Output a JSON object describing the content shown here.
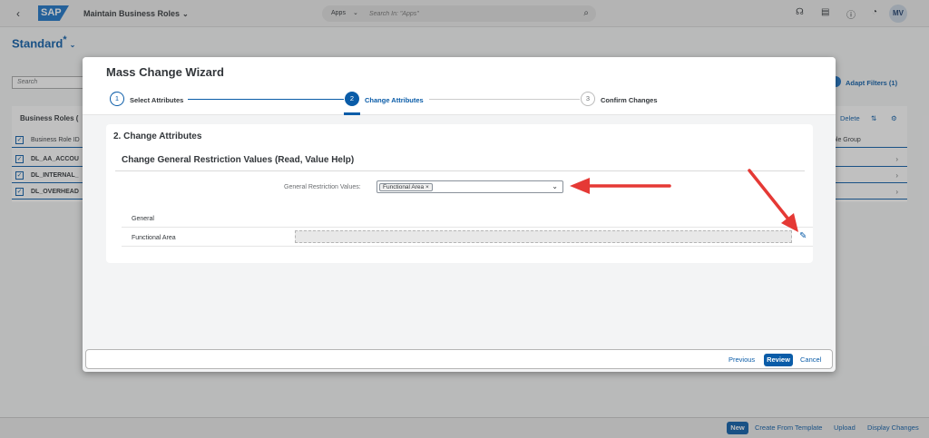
{
  "shell": {
    "back_icon": "‹",
    "logo": "SAP",
    "app_title": "Maintain Business Roles",
    "search_scope": "Apps",
    "search_placeholder": "Search In: \"Apps\"",
    "avatar_initials": "MV"
  },
  "page": {
    "variant": "Standard",
    "variant_marker": "*",
    "search_placeholder": "Search",
    "adapt_filters": "Adapt Filters (1)",
    "table_title": "Business Roles (",
    "delete_label": "Delete",
    "column_id": "Business Role ID",
    "column_group": "ole Group",
    "rows": [
      "DL_AA_ACCOU",
      "DL_INTERNAL_",
      "DL_OVERHEAD"
    ]
  },
  "footer": {
    "new": "New",
    "create_template": "Create From Template",
    "upload": "Upload",
    "display_changes": "Display Changes"
  },
  "dialog": {
    "title": "Mass Change Wizard",
    "steps": [
      {
        "number": "1",
        "label": "Select Attributes"
      },
      {
        "number": "2",
        "label": "Change Attributes"
      },
      {
        "number": "3",
        "label": "Confirm Changes"
      }
    ],
    "section_title": "2. Change Attributes",
    "subsection_title": "Change General Restriction Values (Read, Value Help)",
    "grv_label": "General Restriction Values:",
    "grv_token": "Functional Area",
    "token_close": "×",
    "column_header": "General",
    "row_label": "Functional Area",
    "previous": "Previous",
    "review": "Review",
    "cancel": "Cancel"
  },
  "colors": {
    "accent": "#0a5ca8",
    "annotation_arrow": "#e53935"
  }
}
